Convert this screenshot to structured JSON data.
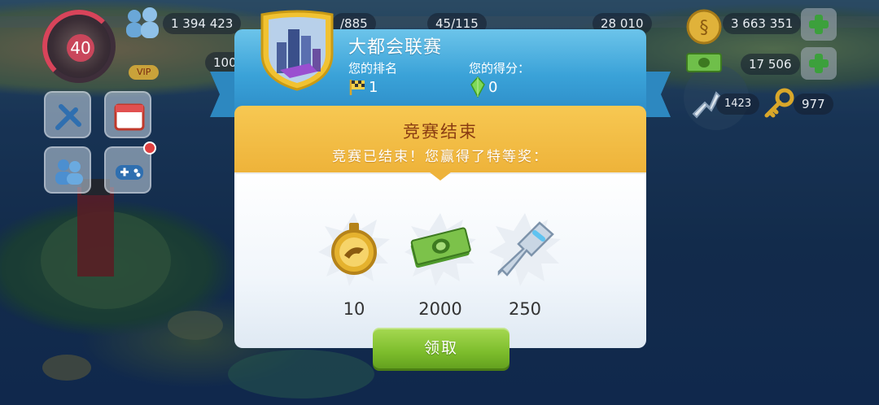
{
  "hud": {
    "level": "40",
    "population": "1 394 423",
    "storage": "/885",
    "workers": "45/115",
    "global_trade": "28 010",
    "premium": "100",
    "simoleons": "3 663 351",
    "simcash": "17 506",
    "platinum_keys": "1423",
    "golden_keys": "977",
    "vip_label": "VIP"
  },
  "dialog": {
    "league_title": "大都会联赛",
    "rank_label": "您的排名",
    "rank_value": "1",
    "score_label": "您的得分：",
    "score_value": "0",
    "banner_title": "竞赛结束",
    "banner_subtitle": "竞赛已结束！您赢得了特等奖：",
    "rewards": [
      {
        "icon": "speedup-token-icon",
        "qty": "10"
      },
      {
        "icon": "simoleon-cash-icon",
        "qty": "2000"
      },
      {
        "icon": "platinum-key-icon",
        "qty": "250"
      }
    ],
    "claim_label": "领取"
  },
  "colors": {
    "header_blue": "#3aa2d8",
    "banner_gold": "#eeb33a",
    "banner_title": "#8a3c12",
    "claim_green": "#7dbd2c"
  }
}
